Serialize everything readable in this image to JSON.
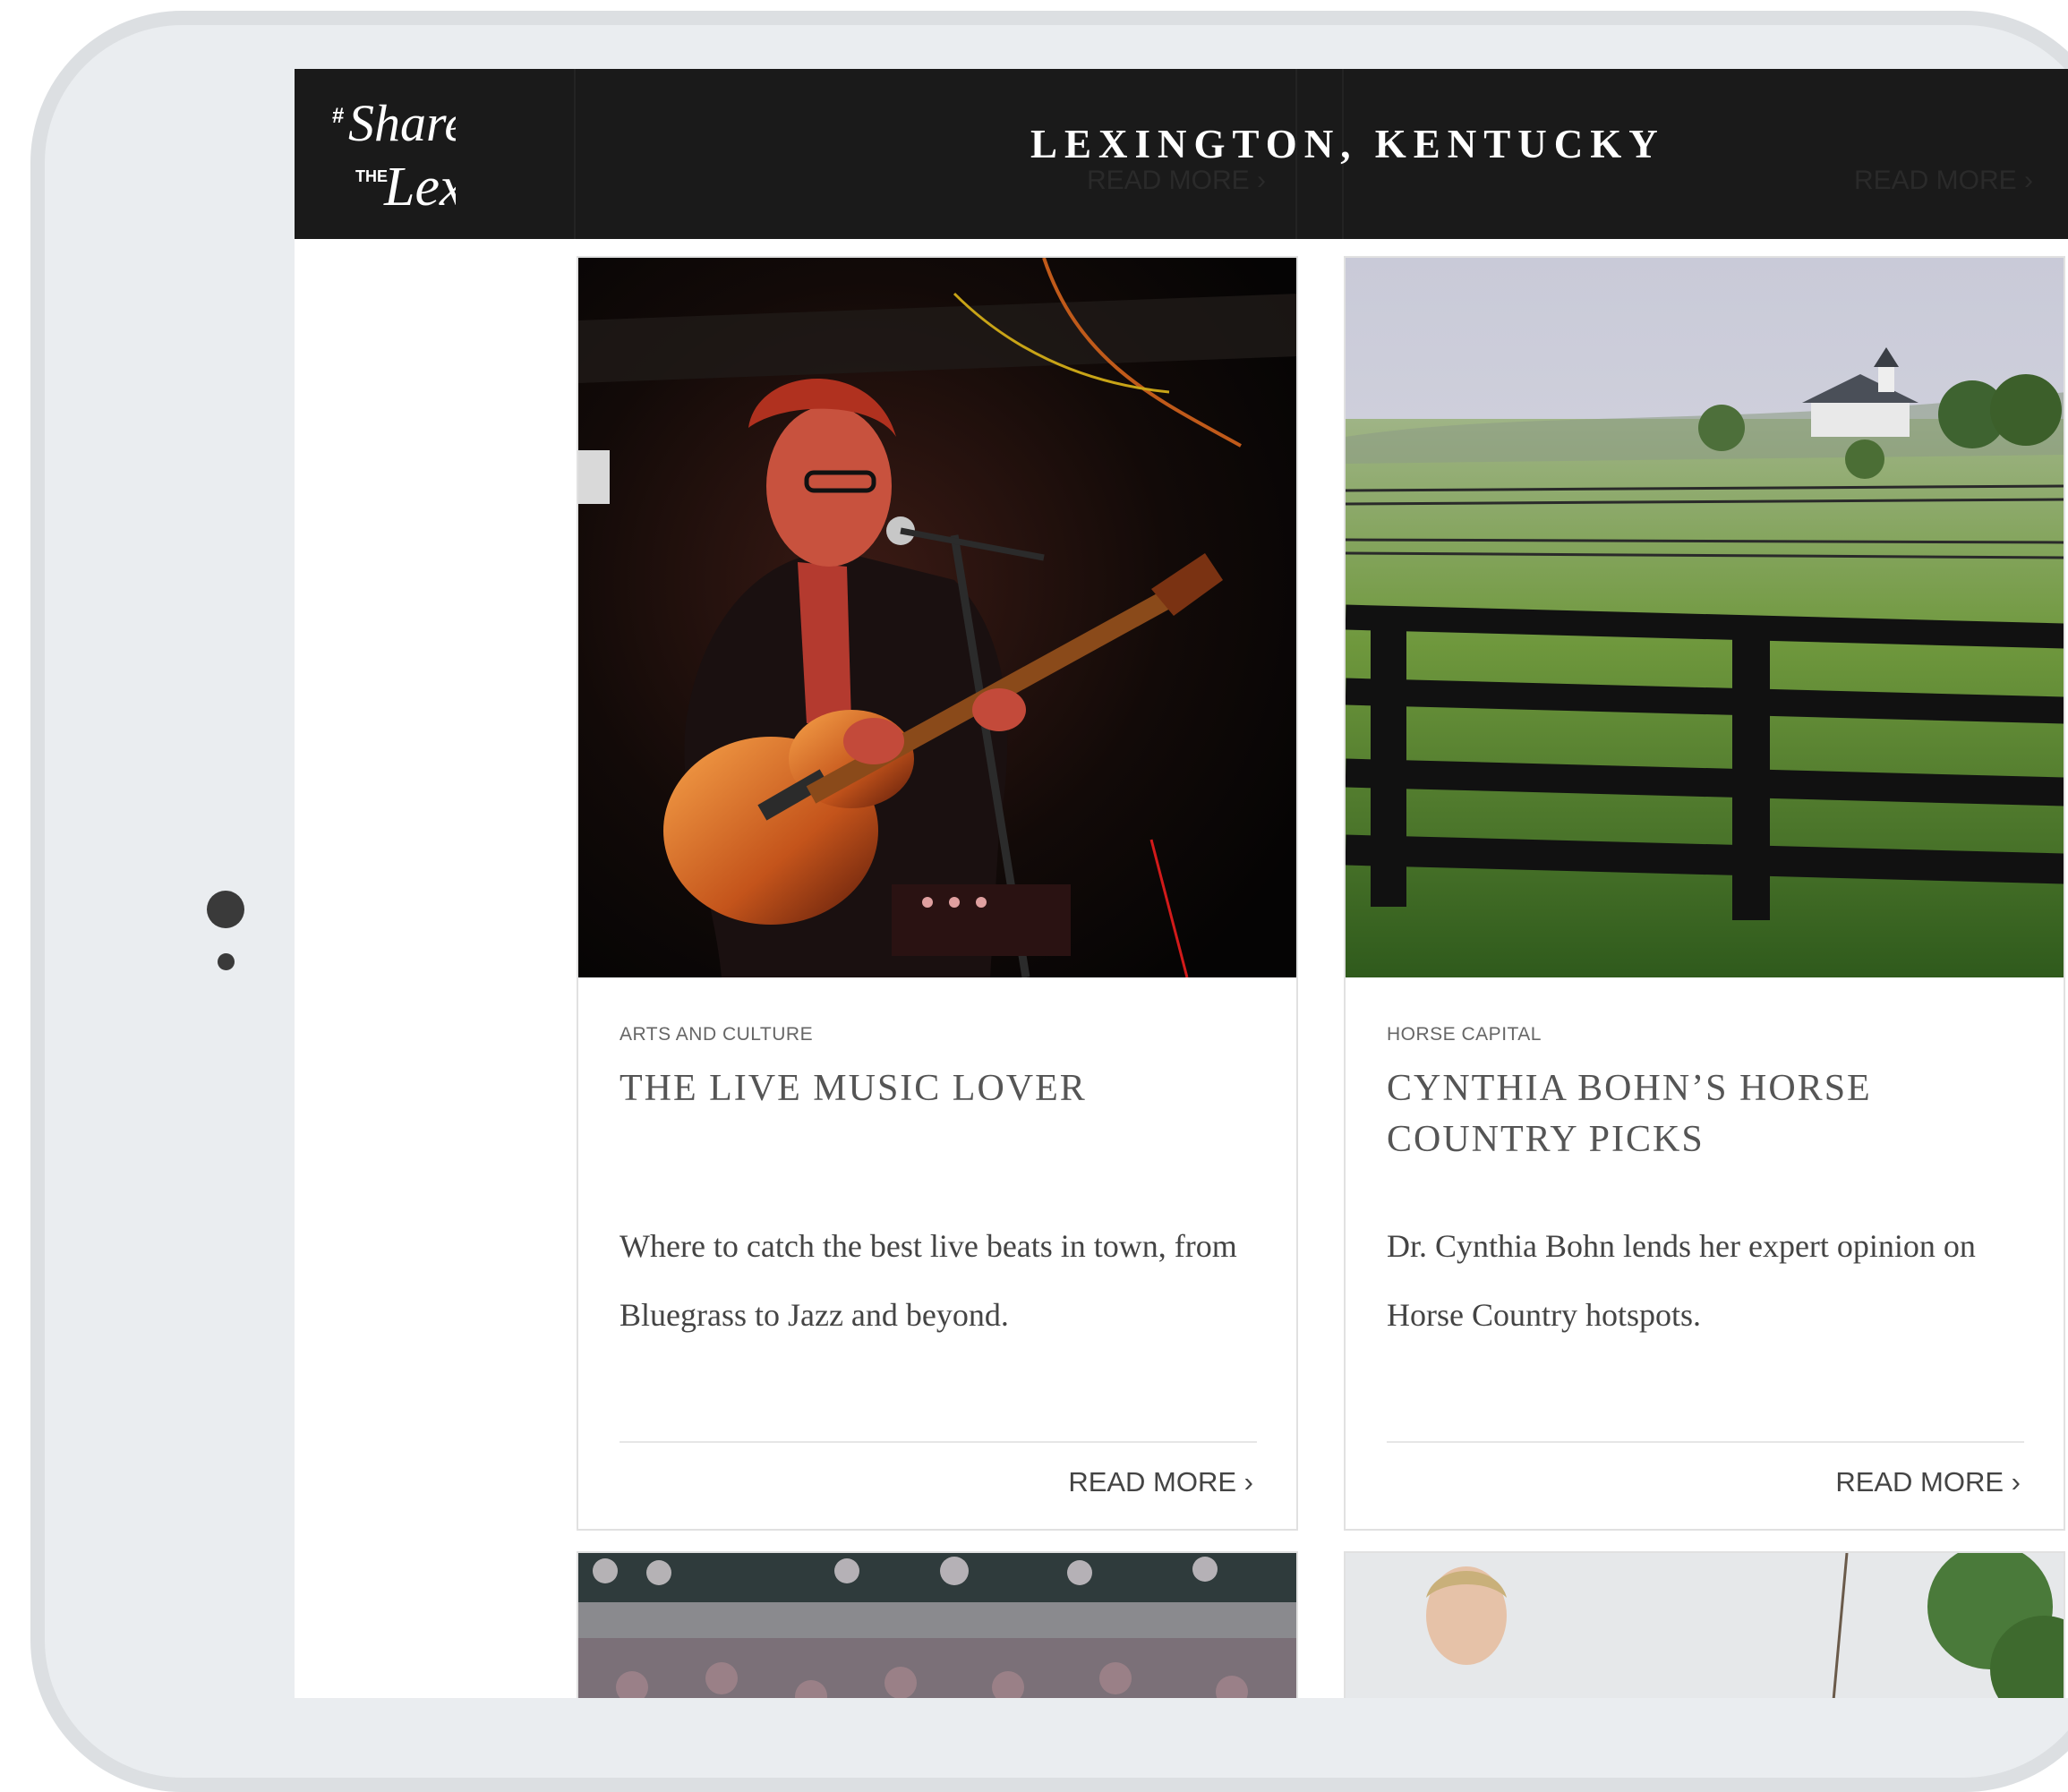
{
  "header": {
    "logo_text": "#Share the Lex",
    "title": "LEXINGTON, KENTUCKY",
    "ghost_links": [
      "READ MORE ›",
      "READ MORE ›"
    ]
  },
  "cards": [
    {
      "category": "ARTS AND CULTURE",
      "title": "THE LIVE MUSIC LOVER",
      "description": "Where to catch the best live beats in town, from Bluegrass to Jazz and beyond.",
      "read_more": "READ MORE ›"
    },
    {
      "category": "HORSE CAPITAL",
      "title": "CYNTHIA BOHN’S HORSE COUNTRY PICKS",
      "description": "Dr. Cynthia Bohn lends her expert opinion on Horse Country hotspots.",
      "read_more": "READ MORE ›"
    }
  ],
  "colors": {
    "header_bg": "#1a1a1a",
    "device_frame": "#dcdfe2",
    "text_title": "#555555"
  }
}
